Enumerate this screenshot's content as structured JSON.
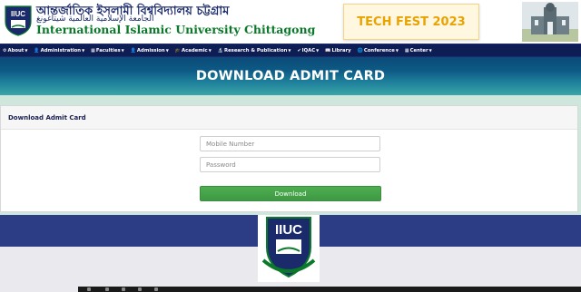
{
  "header": {
    "logo_text": "IIUC",
    "bangla_name": "আন্তর্জাতিক ইসলামী বিশ্ববিদ্যালয় চট্টগ্রাম",
    "arabic_name": "الجامعة الإسلامية العالمية شيتاغونغ",
    "english_name": "International Islamic University Chittagong",
    "promo": "TECH FEST 2023"
  },
  "nav": {
    "items": [
      {
        "icon": "⚙",
        "label": "About"
      },
      {
        "icon": "👤",
        "label": "Administration"
      },
      {
        "icon": "▦",
        "label": "Faculties"
      },
      {
        "icon": "👤",
        "label": "Admission"
      },
      {
        "icon": "🎓",
        "label": "Academic"
      },
      {
        "icon": "🔬",
        "label": "Research & Publication"
      },
      {
        "icon": "✔",
        "label": "IQAC"
      },
      {
        "icon": "📖",
        "label": "Library"
      },
      {
        "icon": "🌐",
        "label": "Conference"
      },
      {
        "icon": "▦",
        "label": "Center"
      }
    ]
  },
  "banner": {
    "title": "DOWNLOAD ADMIT CARD"
  },
  "form": {
    "card_title": "Download Admit Card",
    "mobile_placeholder": "Mobile Number",
    "password_placeholder": "Password",
    "submit_label": "Download"
  },
  "footer": {
    "logo_text": "IIUC"
  },
  "colors": {
    "navy": "#0f1d55",
    "green": "#0a7a2a",
    "button_green": "#45a348",
    "promo_gold": "#e8a300"
  }
}
